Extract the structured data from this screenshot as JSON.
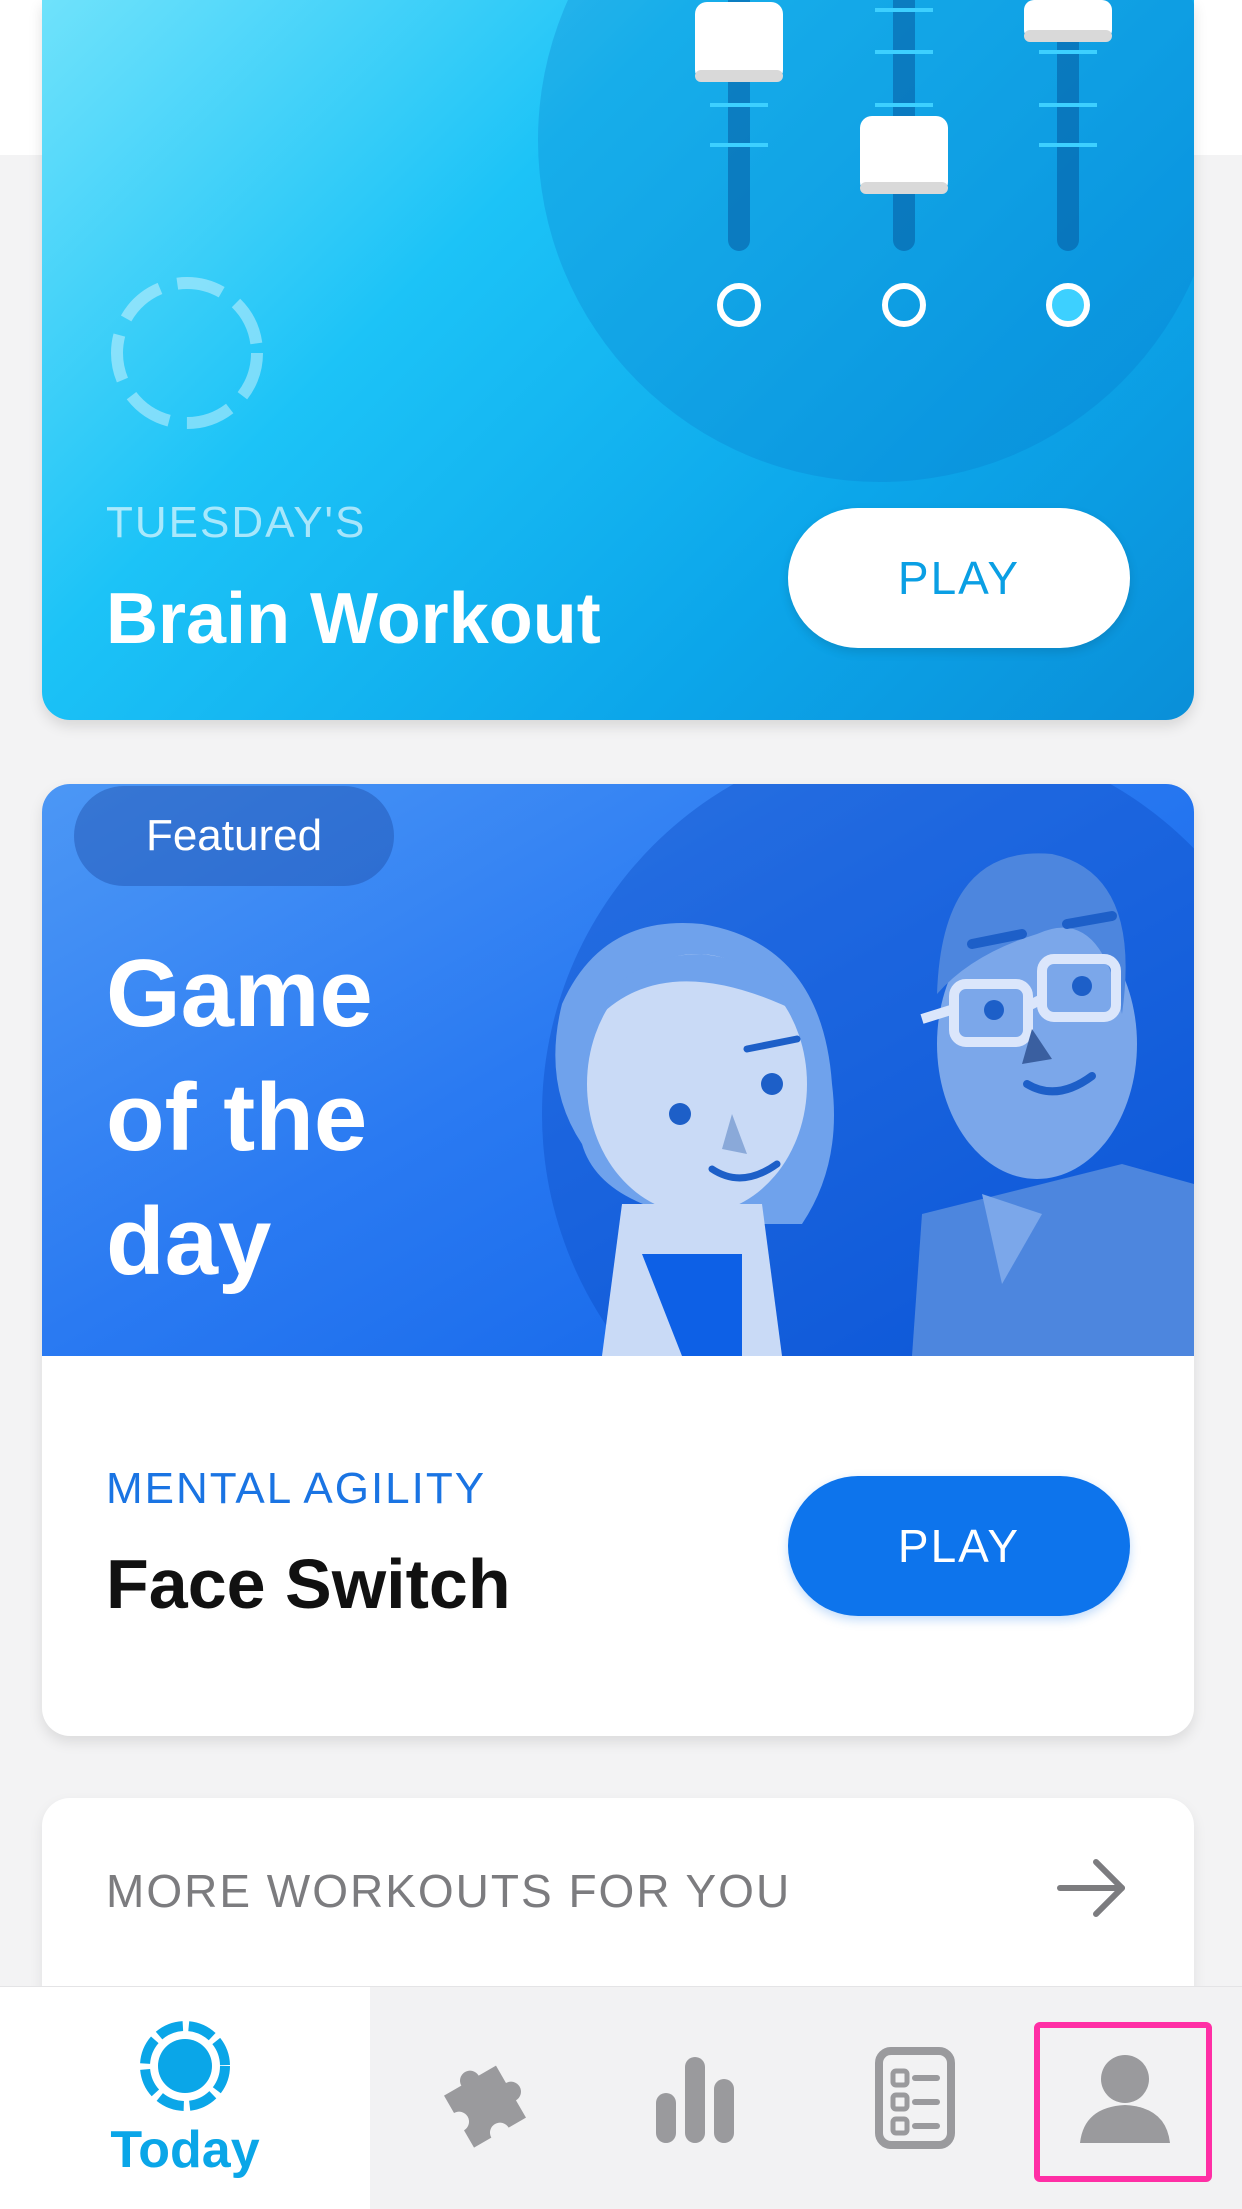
{
  "colors": {
    "workout_gradient": [
      "#6fe2fb",
      "#0a8fd8"
    ],
    "featured_gradient": [
      "#4c97f5",
      "#0d60e6"
    ],
    "accent_blue": "#0d74ec",
    "today_active": "#0aa6e8",
    "tab_inactive": "#9a9a9d",
    "annotation_pink": "#ff2fa5"
  },
  "workout_card": {
    "subtitle": "TUESDAY'S",
    "title": "Brain Workout",
    "play_label": "PLAY",
    "icons": [
      "sliders-illustration",
      "progress-ring-icon"
    ]
  },
  "featured_card": {
    "badge": "Featured",
    "title_lines": [
      "Game",
      "of the",
      "day"
    ],
    "category": "MENTAL AGILITY",
    "game_name": "Face Switch",
    "play_label": "PLAY",
    "illustration": "faces-illustration"
  },
  "more_card": {
    "label": "MORE WORKOUTS FOR YOU",
    "icon": "arrow-right-icon"
  },
  "tabbar": {
    "tabs": [
      {
        "id": "today",
        "label": "Today",
        "icon": "today-ring-icon",
        "active": true
      },
      {
        "id": "games",
        "label": "",
        "icon": "puzzle-icon",
        "active": false
      },
      {
        "id": "stats",
        "label": "",
        "icon": "bar-chart-icon",
        "active": false
      },
      {
        "id": "list",
        "label": "",
        "icon": "checklist-icon",
        "active": false
      },
      {
        "id": "profile",
        "label": "",
        "icon": "person-icon",
        "active": false
      }
    ]
  }
}
